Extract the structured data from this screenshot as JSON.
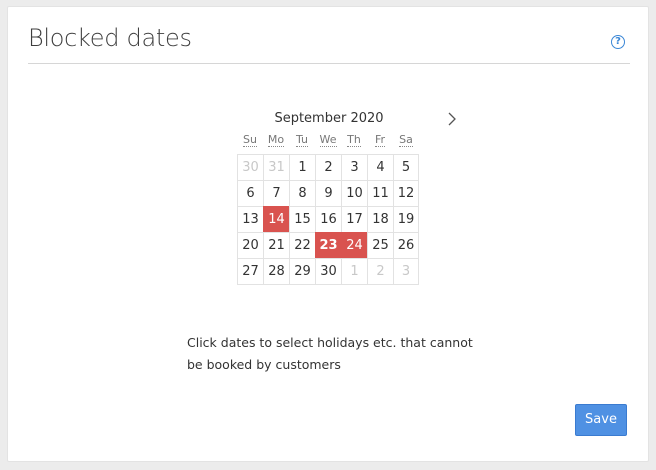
{
  "panel": {
    "title": "Blocked dates",
    "help_icon": "question-circle-icon",
    "help_glyph": "?"
  },
  "calendar": {
    "month_label": "September 2020",
    "next_icon": "chevron-right-icon",
    "weekdays": [
      "Su",
      "Mo",
      "Tu",
      "We",
      "Th",
      "Fr",
      "Sa"
    ],
    "weeks": [
      [
        {
          "d": "30",
          "muted": true
        },
        {
          "d": "31",
          "muted": true
        },
        {
          "d": "1"
        },
        {
          "d": "2"
        },
        {
          "d": "3"
        },
        {
          "d": "4"
        },
        {
          "d": "5"
        }
      ],
      [
        {
          "d": "6"
        },
        {
          "d": "7"
        },
        {
          "d": "8"
        },
        {
          "d": "9"
        },
        {
          "d": "10"
        },
        {
          "d": "11"
        },
        {
          "d": "12"
        }
      ],
      [
        {
          "d": "13"
        },
        {
          "d": "14",
          "blocked": true
        },
        {
          "d": "15"
        },
        {
          "d": "16"
        },
        {
          "d": "17"
        },
        {
          "d": "18"
        },
        {
          "d": "19"
        }
      ],
      [
        {
          "d": "20"
        },
        {
          "d": "21"
        },
        {
          "d": "22"
        },
        {
          "d": "23",
          "blocked": true,
          "bold": true
        },
        {
          "d": "24",
          "blocked": true
        },
        {
          "d": "25"
        },
        {
          "d": "26"
        }
      ],
      [
        {
          "d": "27"
        },
        {
          "d": "28"
        },
        {
          "d": "29"
        },
        {
          "d": "30"
        },
        {
          "d": "1",
          "muted": true
        },
        {
          "d": "2",
          "muted": true
        },
        {
          "d": "3",
          "muted": true
        }
      ]
    ],
    "blocked_color": "#d9534f"
  },
  "hint": {
    "text": "Click dates to select holidays etc. that cannot be booked by customers"
  },
  "actions": {
    "save_label": "Save",
    "save_color": "#4f91e3"
  }
}
